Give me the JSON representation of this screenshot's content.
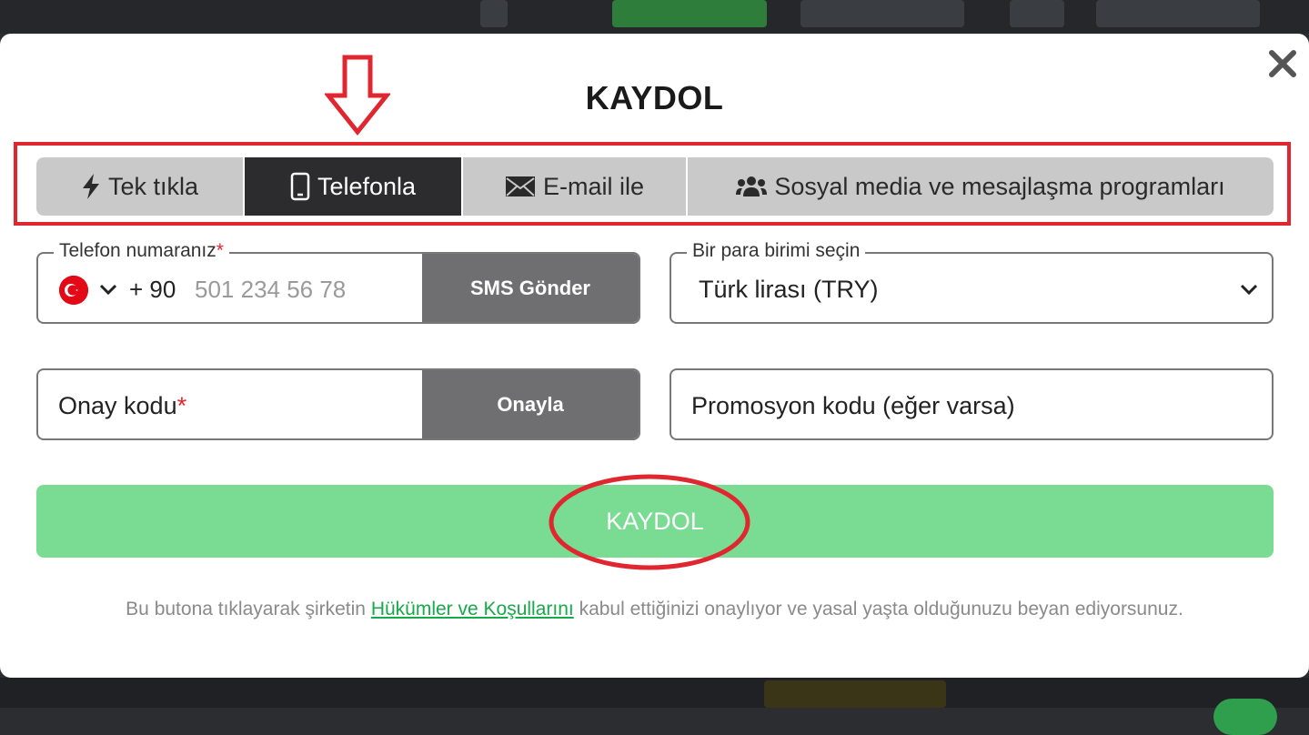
{
  "modal": {
    "title": "KAYDOL",
    "close_icon": "close-icon"
  },
  "tabs": [
    {
      "label": "Tek tıkla",
      "icon": "lightning-icon",
      "active": false
    },
    {
      "label": "Telefonla",
      "icon": "mobile-phone-icon",
      "active": true
    },
    {
      "label": "E-mail ile",
      "icon": "envelope-icon",
      "active": false
    },
    {
      "label": "Sosyal media ve mesajlaşma programları",
      "icon": "users-group-icon",
      "active": false
    }
  ],
  "phone": {
    "legend": "Telefon numaranız",
    "required_mark": "*",
    "country_code": "+ 90",
    "placeholder": "501 234 56 78",
    "flag_icon": "turkey-flag-icon",
    "sms_button": "SMS Gönder"
  },
  "currency": {
    "legend": "Bir para birimi seçin",
    "selected": "Türk lirası (TRY)"
  },
  "confirm": {
    "placeholder": "Onay kodu",
    "required_mark": "*",
    "button": "Onayla"
  },
  "promo": {
    "placeholder": "Promosyon kodu (eğer varsa)"
  },
  "submit": {
    "label": "KAYDOL"
  },
  "terms": {
    "before": "Bu butona tıklayarak şirketin ",
    "link": "Hükümler ve Koşullarını",
    "after": " kabul ettiğinizi onaylıyor ve yasal yaşta olduğunuzu beyan ediyorsunuz."
  },
  "colors": {
    "annotation_red": "#e0262f",
    "submit_green": "#79dc92",
    "link_green": "#17a94a",
    "active_tab": "#2c2c2e"
  }
}
